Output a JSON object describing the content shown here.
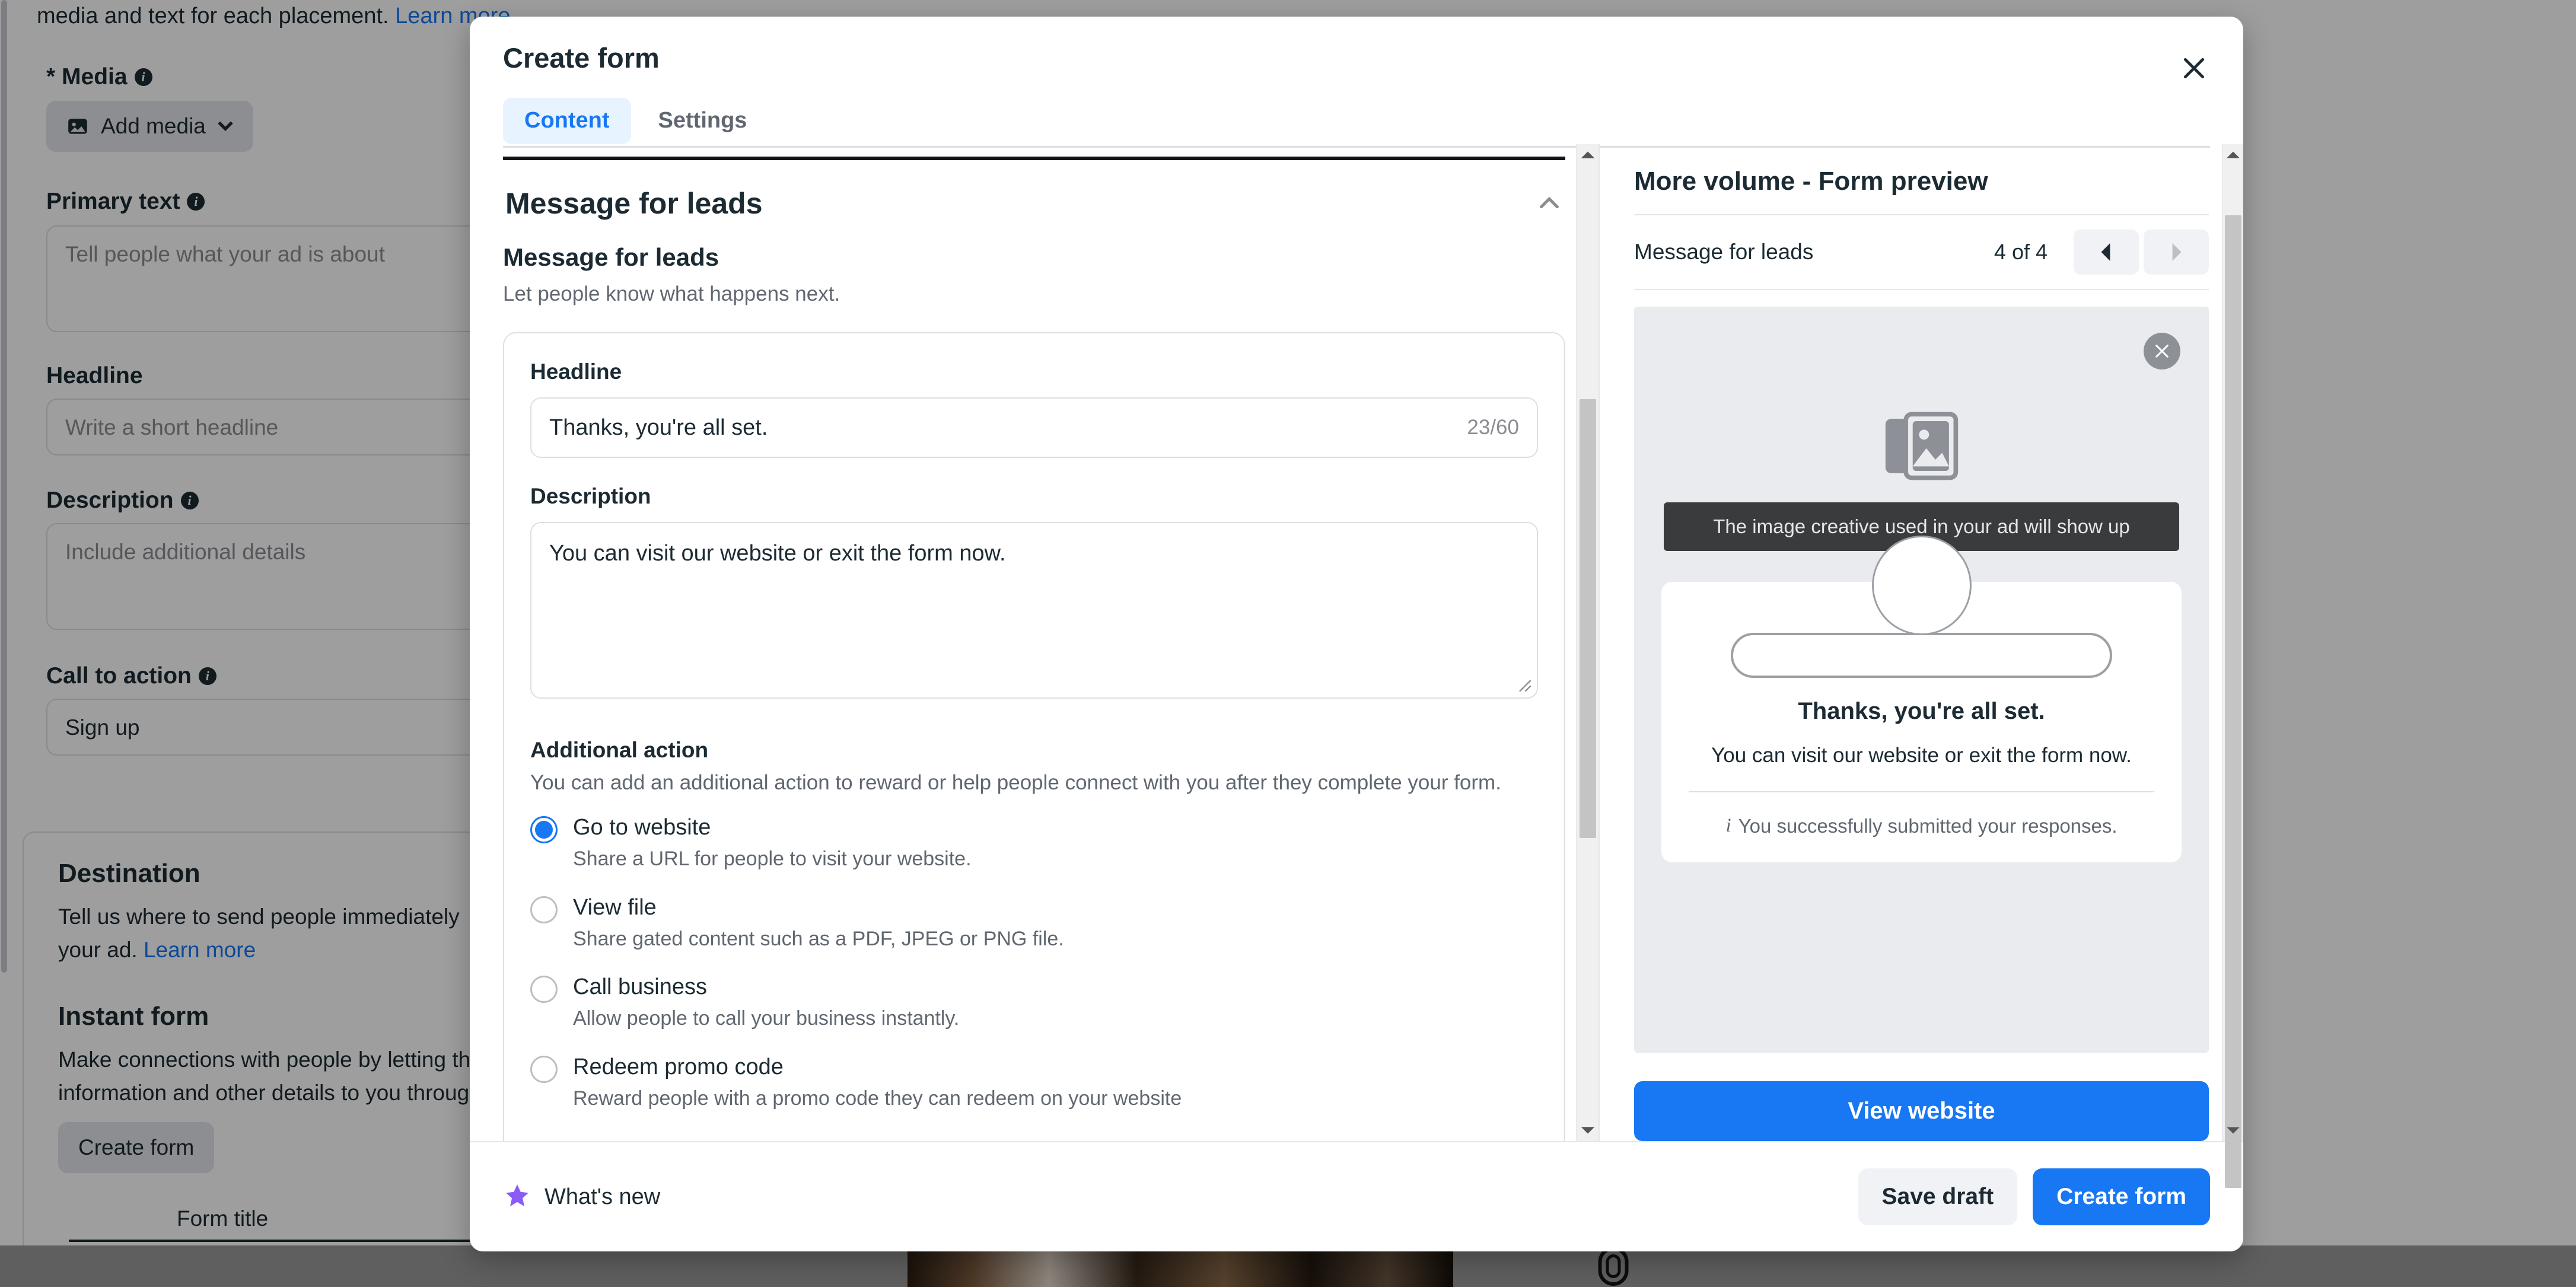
{
  "background": {
    "top_note": "media and text for each placement.",
    "top_note_link": "Learn more",
    "media_label": "* Media",
    "add_media_button": "Add media",
    "primary_text_label": "Primary text",
    "primary_text_placeholder": "Tell people what your ad is about",
    "headline_label": "Headline",
    "headline_placeholder": "Write a short headline",
    "description_label": "Description",
    "description_placeholder": "Include additional details",
    "cta_label": "Call to action",
    "cta_value": "Sign up",
    "destination_title": "Destination",
    "destination_desc_line1": "Tell us where to send people immediately",
    "destination_desc_line2": "your ad.",
    "destination_link": "Learn more",
    "instant_form_title": "Instant form",
    "instant_form_desc_line1": "Make connections with people by letting th",
    "instant_form_desc_line2": "information and other details to you throug",
    "create_form_button": "Create form",
    "form_title_label": "Form title"
  },
  "modal": {
    "title": "Create form",
    "close_icon": "close-icon",
    "tabs": [
      {
        "label": "Content",
        "active": true
      },
      {
        "label": "Settings",
        "active": false
      }
    ],
    "footer": {
      "whats_new": "What's new",
      "whats_new_icon": "star-icon",
      "save_draft": "Save draft",
      "create_form": "Create form"
    }
  },
  "content": {
    "section_header": "Message for leads",
    "collapse_icon": "chevron-up-icon",
    "block_title": "Message for leads",
    "block_sub": "Let people know what happens next.",
    "headline": {
      "label": "Headline",
      "value": "Thanks, you're all set.",
      "char_count": "23/60"
    },
    "description": {
      "label": "Description",
      "value": "You can visit our website or exit the form now."
    },
    "additional_action": {
      "title": "Additional action",
      "sub": "You can add an additional action to reward or help people connect with you after they complete your form.",
      "options": [
        {
          "label": "Go to website",
          "desc": "Share a URL for people to visit your website.",
          "selected": true
        },
        {
          "label": "View file",
          "desc": "Share gated content such as a PDF, JPEG or PNG file.",
          "selected": false
        },
        {
          "label": "Call business",
          "desc": "Allow people to call your business instantly.",
          "selected": false
        },
        {
          "label": "Redeem promo code",
          "desc": "Reward people with a promo code they can redeem on your website",
          "selected": false
        }
      ]
    }
  },
  "preview": {
    "title": "More volume - Form preview",
    "step_label": "Message for leads",
    "step_count": "4 of 4",
    "prev_icon": "chevron-left-icon",
    "next_icon": "chevron-right-icon",
    "close_icon": "close-circle-icon",
    "image_placeholder_icon": "image-icon",
    "tooltip": "The image creative used in your ad will show up",
    "headline": "Thanks, you're all set.",
    "description": "You can visit our website or exit the form now.",
    "note": "You successfully submitted your responses.",
    "note_icon": "info-icon",
    "cta_button": "View website"
  },
  "colors": {
    "accent": "#1877f2",
    "tab_active_bg": "#e7f3ff",
    "whats_new": "#8a5cf6",
    "text_primary": "#1c2b33",
    "text_secondary": "#606770"
  }
}
